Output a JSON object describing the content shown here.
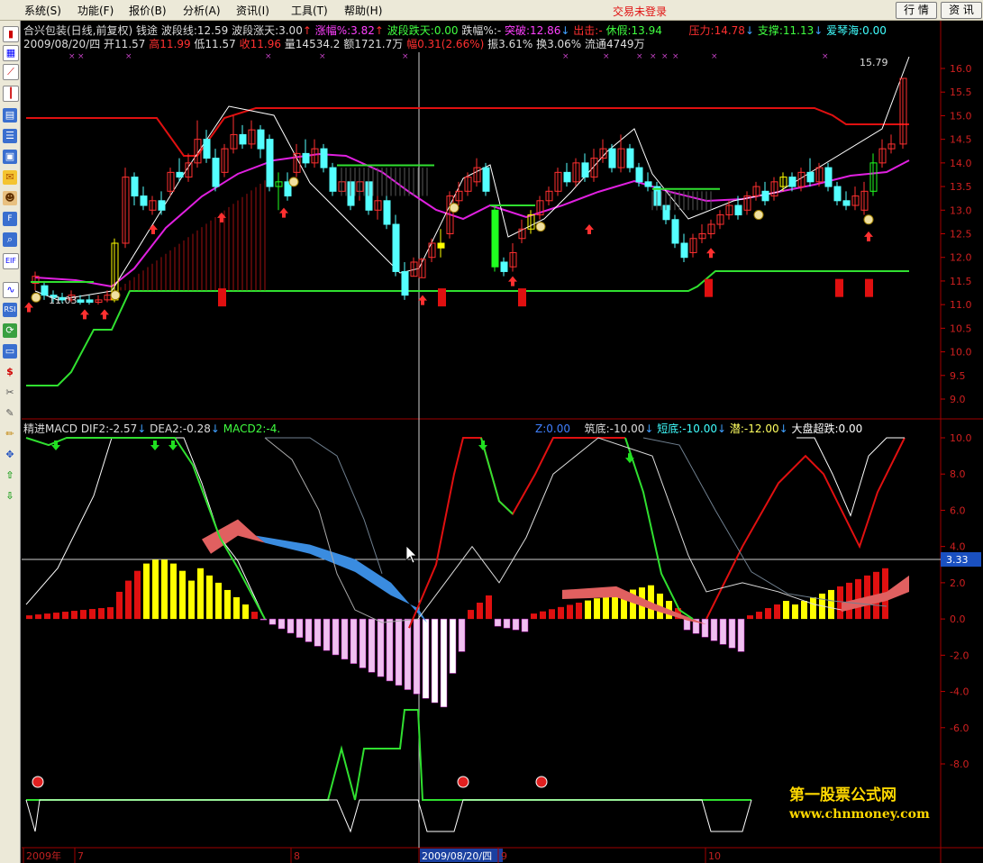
{
  "menu": {
    "items": [
      "系统(S)",
      "功能(F)",
      "报价(B)",
      "分析(A)",
      "资讯(I)",
      "工具(T)",
      "帮助(H)"
    ],
    "login_status": "交易未登录",
    "btn_quote": "行 情",
    "btn_info": "资 讯"
  },
  "stock": {
    "name_line": "合兴包装(日线,前复权) 钱途",
    "wave_line": "波段线:12.59",
    "wave_up": "波段涨天:3.00",
    "rise_pct": "涨幅%:3.82",
    "wave_down": "波段跌天:0.00",
    "fall_pct": "跌幅%:-",
    "breakout": "突破:12.86",
    "exit": "出击:-",
    "rest": "休假:13.94",
    "pressure": "压力:14.78",
    "support": "支撑:11.13",
    "love": "爱琴海:0.00",
    "date_line": "2009/08/20/四",
    "open": "开11.57",
    "high": "高11.99",
    "low": "低11.57",
    "close": "收11.96",
    "volume": "量14534.2",
    "amount": "额1721.7万",
    "change": "幅0.31(2.66%)",
    "amplitude": "振3.61%",
    "turnover": "换3.06%",
    "float": "流通4749万"
  },
  "price_axis": [
    "16.0",
    "15.5",
    "15.0",
    "14.5",
    "14.0",
    "13.5",
    "13.0",
    "12.5",
    "12.0",
    "11.5",
    "11.0",
    "10.5",
    "10.0",
    "9.5",
    "9.0"
  ],
  "price_marks": {
    "high_label": "15.79",
    "low_label": "11.03"
  },
  "macd": {
    "title": "精进MACD",
    "dif": "DIF2:-2.57",
    "dea": "DEA2:-0.28",
    "macd": "MACD2:-4.",
    "z": "Z:0.00",
    "build_bottom": "筑底:-10.00",
    "short_bottom": "短底:-10.00",
    "dive": "潜:-12.00",
    "market_fall": "大盘超跌:0.00",
    "cursor_value": "3.33"
  },
  "macd_axis": [
    "10.0",
    "8.0",
    "6.0",
    "4.0",
    "2.0",
    "0.0",
    "-2.0",
    "-4.0",
    "-6.0",
    "-8.0"
  ],
  "date_axis": [
    "2009年",
    "7",
    "8",
    "2009/08/20/四",
    "9",
    "10"
  ],
  "watermark": {
    "line1": "第一股票公式网",
    "line2": "www.chnmoney.com"
  },
  "colors": {
    "up": "#ff2020",
    "down": "#54ffff",
    "axis": "#c00000",
    "menu_bg": "#ece9d8"
  },
  "toolbar_icons": [
    "chart-icon",
    "grid-icon",
    "line-icon",
    "candle-icon",
    "table-icon",
    "list-icon",
    "doc-icon",
    "mail-icon",
    "people-icon",
    "f10-icon",
    "zoom-icon",
    "etf-icon",
    "wave-icon",
    "rsi-icon",
    "refresh-icon",
    "dollar-icon",
    "tool-icon",
    "pen-icon",
    "move-icon",
    "up-arrow-icon",
    "down-arrow-icon"
  ]
}
